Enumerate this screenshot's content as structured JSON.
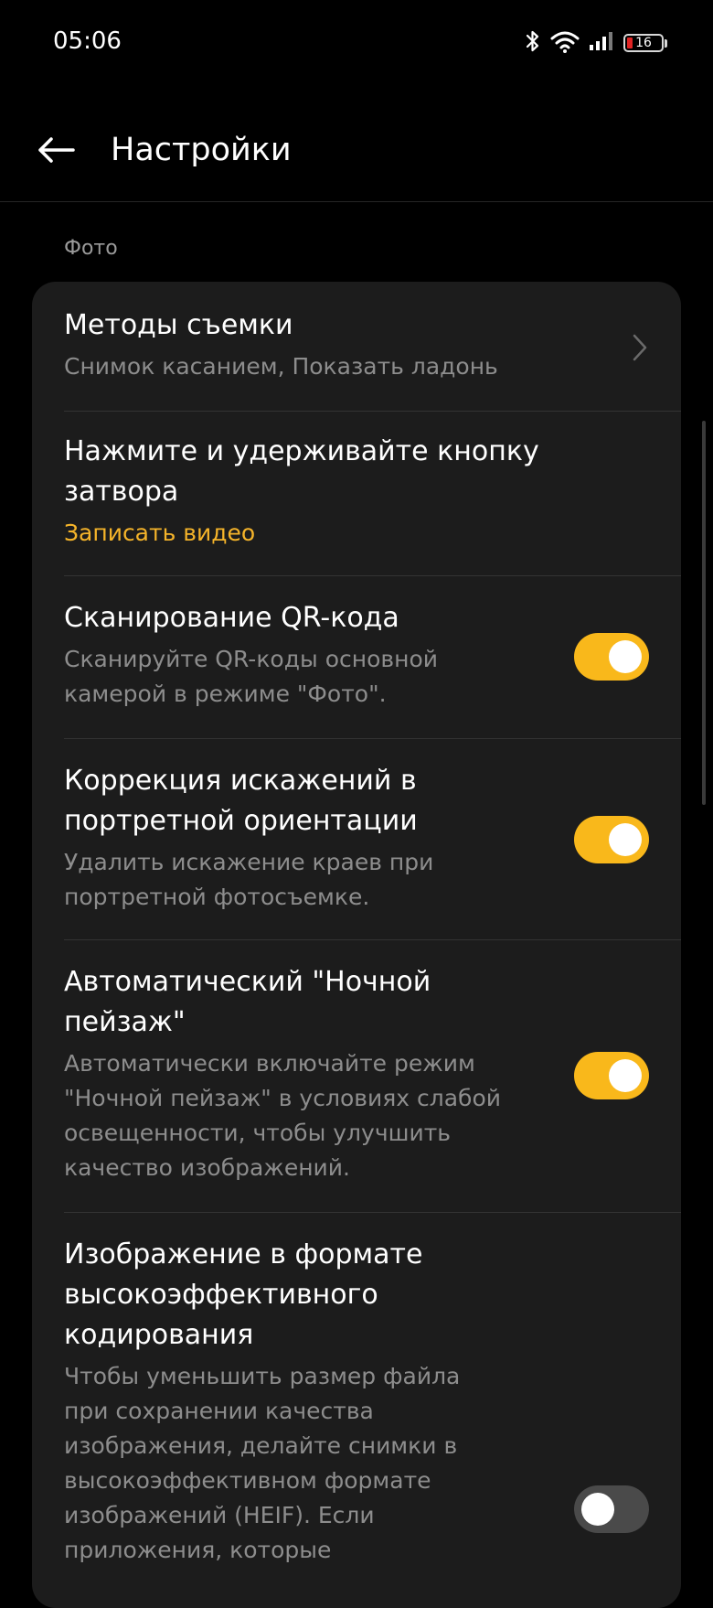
{
  "status": {
    "time": "05:06",
    "battery": "16",
    "icons": [
      "bluetooth-icon",
      "wifi-icon",
      "signal-icon",
      "battery-icon"
    ]
  },
  "header": {
    "title": "Настройки",
    "back_icon": "arrow-left-icon"
  },
  "section": {
    "label": "Фото"
  },
  "colors": {
    "accent": "#f5b42a",
    "toggle_on": "#f9b81b",
    "card_bg": "#1c1c1c",
    "battery_low": "#e02424"
  },
  "settings": [
    {
      "title": "Методы съемки",
      "subtitle": "Снимок касанием, Показать ладонь",
      "control": "chevron"
    },
    {
      "title": "Нажмите и удерживайте кнопку затвора",
      "subtitle": "Записать видео",
      "control": "none"
    },
    {
      "title": "Сканирование QR-кода",
      "subtitle": "Сканируйте QR-коды основной камерой в режиме \"Фото\".",
      "control": "toggle",
      "enabled": true
    },
    {
      "title": "Коррекция искажений в портретной ориентации",
      "subtitle": "Удалить искажение краев при портретной фотосъемке.",
      "control": "toggle",
      "enabled": true
    },
    {
      "title": "Автоматический \"Ночной пейзаж\"",
      "subtitle": "Автоматически включайте режим \"Ночной пейзаж\" в условиях слабой освещенности, чтобы улучшить качество изображений.",
      "control": "toggle",
      "enabled": true
    },
    {
      "title": "Изображение в формате высокоэффективного кодирования",
      "subtitle": "Чтобы уменьшить размер файла при сохранении качества изображения, делайте снимки в высокоэффективном формате изображений (HEIF). Если приложения, которые",
      "control": "toggle",
      "enabled": false
    }
  ]
}
